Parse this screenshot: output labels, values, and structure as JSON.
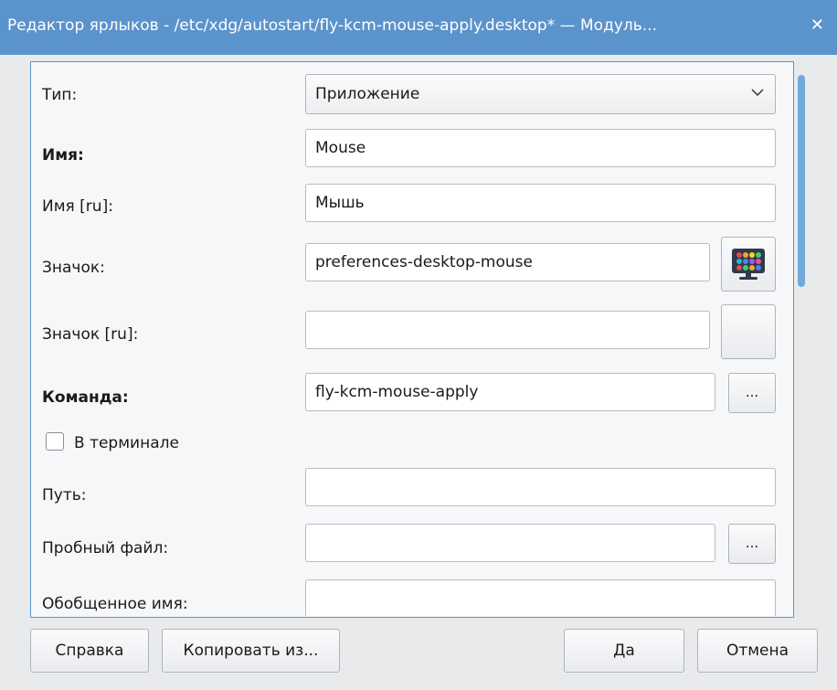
{
  "window": {
    "title": "Редактор ярлыков - /etc/xdg/autostart/fly-kcm-mouse-apply.desktop* — Модуль...",
    "close_glyph": "✕"
  },
  "form": {
    "type": {
      "label": "Тип:",
      "value": "Приложение"
    },
    "name": {
      "label": "Имя:",
      "value": "Mouse"
    },
    "name_ru": {
      "label": "Имя [ru]:",
      "value": "Мышь"
    },
    "icon": {
      "label": "Значок:",
      "value": "preferences-desktop-mouse",
      "icon_name": "preferences-desktop-mouse-icon"
    },
    "icon_ru": {
      "label": "Значок [ru]:",
      "value": ""
    },
    "command": {
      "label": "Команда:",
      "value": "fly-kcm-mouse-apply",
      "browse": "..."
    },
    "terminal": {
      "label": "В терминале",
      "checked": false
    },
    "path": {
      "label": "Путь:",
      "value": ""
    },
    "try_file": {
      "label": "Пробный файл:",
      "value": "",
      "browse": "..."
    },
    "generic_name": {
      "label": "Обобщенное имя:",
      "value": ""
    }
  },
  "buttons": {
    "help": "Справка",
    "copy_from": "Копировать из...",
    "ok": "Да",
    "cancel": "Отмена"
  },
  "colors": {
    "titlebar": "#5b93cc",
    "scroll_thumb": "#72a9dc"
  }
}
